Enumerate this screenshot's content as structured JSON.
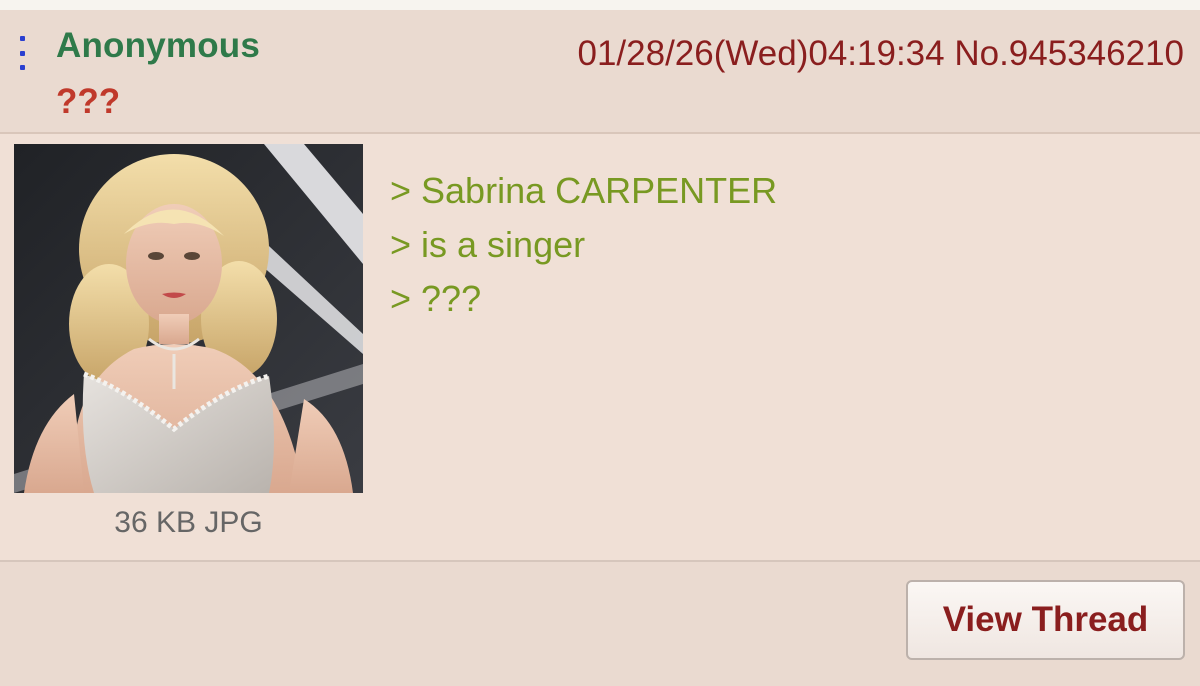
{
  "post": {
    "menu_icon": "vertical-ellipsis-icon",
    "name": "Anonymous",
    "subject": "???",
    "datetime": "01/28/26(Wed)04:19:34",
    "post_number": "No.945346210",
    "file_info": "36 KB JPG",
    "comment_lines": [
      "> Sabrina CARPENTER",
      "> is a singer",
      "> ???"
    ]
  },
  "footer": {
    "view_thread_label": "View Thread"
  },
  "colors": {
    "background": "#f0e0d6",
    "header_background": "#eadad0",
    "name": "#2f7a4a",
    "subject": "#c0392b",
    "meta": "#8a1e1e",
    "greentext": "#789922",
    "file_info": "#666666",
    "menu_icon": "#2a3fd0"
  }
}
